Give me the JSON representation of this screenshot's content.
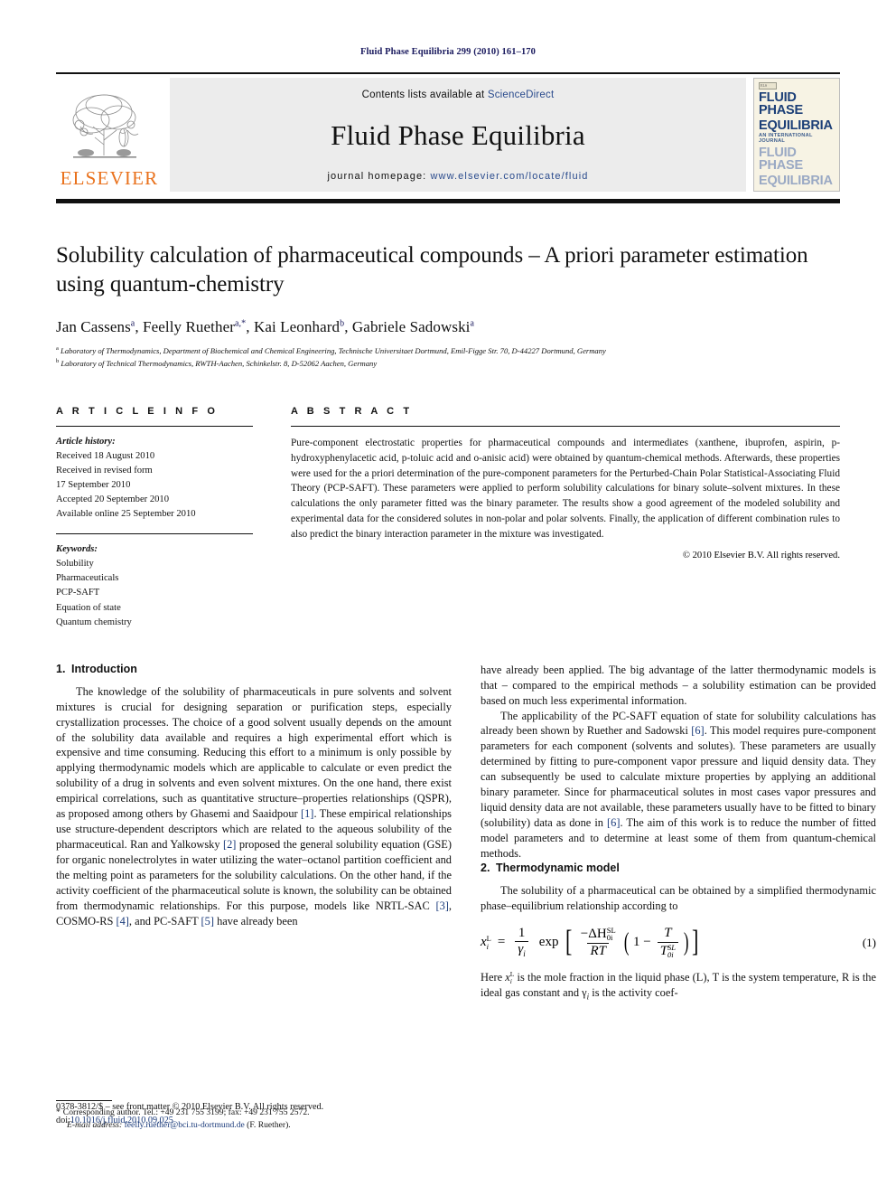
{
  "running_head": "Fluid Phase Equilibria 299 (2010) 161–170",
  "masthead": {
    "contents_prefix": "Contents lists available at ",
    "sciencedirect": "ScienceDirect",
    "journal_title": "Fluid Phase Equilibria",
    "homepage_label": "journal homepage:",
    "homepage_url": "www.elsevier.com/locate/fluid",
    "publisher_wordmark": "ELSEVIER",
    "publisher_accent_color": "#E9711C",
    "link_color": "#2a4b8d",
    "cover": {
      "line1": "FLUID PHASE",
      "line2": "EQUILIBRIA",
      "line3": "AN INTERNATIONAL JOURNAL",
      "line4": "FLUID PHASE",
      "line5": "EQUILIBRIA"
    }
  },
  "title": "Solubility calculation of pharmaceutical compounds – A priori parameter estimation using quantum-chemistry",
  "authors": [
    {
      "name": "Jan Cassens",
      "marks": "a"
    },
    {
      "name": "Feelly Ruether",
      "marks": "a,*"
    },
    {
      "name": "Kai Leonhard",
      "marks": "b"
    },
    {
      "name": "Gabriele Sadowski",
      "marks": "a"
    }
  ],
  "affiliations": [
    {
      "mark": "a",
      "text": "Laboratory of Thermodynamics, Department of Biochemical and Chemical Engineering, Technische Universitaet Dortmund, Emil-Figge Str. 70, D-44227 Dortmund, Germany"
    },
    {
      "mark": "b",
      "text": "Laboratory of Technical Thermodynamics, RWTH-Aachen, Schinkelstr. 8, D-52062 Aachen, Germany"
    }
  ],
  "article_info": {
    "heading": "A R T I C L E   I N F O",
    "history_label": "Article history:",
    "history": [
      "Received 18 August 2010",
      "Received in revised form",
      "17 September 2010",
      "Accepted 20 September 2010",
      "Available online 25 September 2010"
    ],
    "keywords_label": "Keywords:",
    "keywords": [
      "Solubility",
      "Pharmaceuticals",
      "PCP-SAFT",
      "Equation of state",
      "Quantum chemistry"
    ]
  },
  "abstract": {
    "heading": "A B S T R A C T",
    "text": "Pure-component electrostatic properties for pharmaceutical compounds and intermediates (xanthene, ibuprofen, aspirin, p-hydroxyphenylacetic acid, p-toluic acid and o-anisic acid) were obtained by quantum-chemical methods. Afterwards, these properties were used for the a priori determination of the pure-component parameters for the Perturbed-Chain Polar Statistical-Associating Fluid Theory (PCP-SAFT). These parameters were applied to perform solubility calculations for binary solute–solvent mixtures. In these calculations the only parameter fitted was the binary parameter. The results show a good agreement of the modeled solubility and experimental data for the considered solutes in non-polar and polar solvents. Finally, the application of different combination rules to also predict the binary interaction parameter in the mixture was investigated.",
    "copyright": "© 2010 Elsevier B.V. All rights reserved."
  },
  "sections": {
    "intro": {
      "number": "1.",
      "title": "Introduction",
      "p1_a": "The knowledge of the solubility of pharmaceuticals in pure solvents and solvent mixtures is crucial for designing separation or purification steps, especially crystallization processes. The choice of a good solvent usually depends on the amount of the solubility data available and requires a high experimental effort which is expensive and time consuming. Reducing this effort to a minimum is only possible by applying thermodynamic models which are applicable to calculate or even predict the solubility of a drug in solvents and even solvent mixtures. On the one hand, there exist empirical correlations, such as quantitative structure–properties relationships (QSPR), as proposed among others by Ghasemi and Saaidpour ",
      "ref1": "[1]",
      "p1_b": ". These empirical relationships use structure-dependent descriptors which are related to the aqueous solubility of the pharmaceutical. Ran and Yalkowsky ",
      "ref2": "[2]",
      "p1_c": " proposed the general solubility equation (GSE) for organic nonelectrolytes in water utilizing the water–octanol partition coefficient and the melting point as parameters for the solubility calculations. On the other hand, if the activity coefficient of the pharmaceutical solute is known, the solubility can be obtained from thermodynamic relationships. For this purpose, models like NRTL-SAC ",
      "ref3": "[3]",
      "p1_d": ", COSMO-RS ",
      "ref4": "[4]",
      "p1_e": ", and PC-SAFT ",
      "ref5": "[5]",
      "p1_f": " have already been applied. The big advantage of the latter thermodynamic models is that – compared to the empirical methods – a solubility estimation can be provided based on much less experimental information.",
      "p2_a": "The applicability of the PC-SAFT equation of state for solubility calculations has already been shown by Ruether and Sadowski ",
      "ref6": "[6]",
      "p2_b": ". This model requires pure-component parameters for each component (solvents and solutes). These parameters are usually determined by fitting to pure-component vapor pressure and liquid density data. They can subsequently be used to calculate mixture properties by applying an additional binary parameter. Since for pharmaceutical solutes in most cases vapor pressures and liquid density data are not available, these parameters usually have to be fitted to binary (solubility) data as done in ",
      "ref6b": "[6]",
      "p2_c": ". The aim of this work is to reduce the number of fitted model parameters and to determine at least some of them from quantum-chemical methods."
    },
    "thermo": {
      "number": "2.",
      "title": "Thermodynamic model",
      "p1": "The solubility of a pharmaceutical can be obtained by a simplified thermodynamic phase–equilibrium relationship according to",
      "p2_a": "Here ",
      "p2_b": " is the mole fraction in the liquid phase (L), T is the system temperature, R is the ideal gas constant and γ",
      "p2_c": " is the activity coef-"
    }
  },
  "equation1": {
    "number": "(1)",
    "lhs_var": "x",
    "lhs_sup": "L",
    "lhs_sub": "i",
    "equals": "=",
    "one": "1",
    "gamma": "γ",
    "gamma_sub": "i",
    "exp": "exp",
    "dh_num": "−ΔH",
    "dh_sup": "SL",
    "dh_sub": "0i",
    "rt": "RT",
    "one_minus": "1 −",
    "t_num": "T",
    "t_den": "T",
    "t_den_sup": "SL",
    "t_den_sub": "0i"
  },
  "footnote": {
    "star": "*",
    "corresponding": "Corresponding author. Tel.: +49 231 755 3199; fax: +49 231 755 2572.",
    "email_label": "E-mail address:",
    "email": "feelly.ruether@bci.tu-dortmund.de",
    "email_owner": "(F. Ruether)."
  },
  "imprint": {
    "line1": "0378-3812/$ – see front matter © 2010 Elsevier B.V. All rights reserved.",
    "doi_label": "doi:",
    "doi": "10.1016/j.fluid.2010.09.025"
  }
}
